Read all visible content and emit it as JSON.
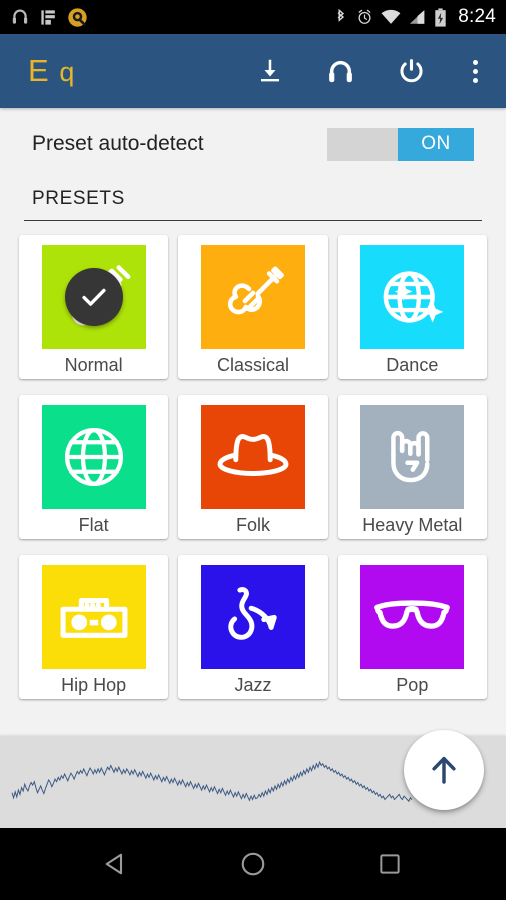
{
  "statusbar": {
    "time": "8:24",
    "left_icons": [
      "headphones-icon",
      "library-icon",
      "audio-app-icon"
    ],
    "right_icons": [
      "bluetooth-icon",
      "alarm-icon",
      "wifi-icon",
      "signal-icon",
      "battery-charging-icon"
    ]
  },
  "appbar": {
    "logo_e": "E",
    "logo_q": "q",
    "actions": [
      {
        "name": "download-icon",
        "label": "Download"
      },
      {
        "name": "headphones-icon",
        "label": "Headphones"
      },
      {
        "name": "power-icon",
        "label": "Power"
      },
      {
        "name": "overflow-menu-icon",
        "label": "More options"
      }
    ],
    "background_color": "#2B5580",
    "logo_color": "#E8B62A"
  },
  "auto_detect": {
    "label": "Preset auto-detect",
    "state": "ON",
    "on_color": "#35A8DC",
    "track_color": "#D4D4D4"
  },
  "presets_section": {
    "title": "PRESETS"
  },
  "presets": [
    {
      "label": "Normal",
      "icon": "guitar-icon",
      "color": "#AEE309",
      "selected": true
    },
    {
      "label": "Classical",
      "icon": "violin-icon",
      "color": "#FFAE10",
      "selected": false
    },
    {
      "label": "Dance",
      "icon": "discoball-icon",
      "color": "#17DCFB",
      "selected": false
    },
    {
      "label": "Flat",
      "icon": "globe-icon",
      "color": "#0AE08C",
      "selected": false
    },
    {
      "label": "Folk",
      "icon": "cowboyhat-icon",
      "color": "#E84607",
      "selected": false
    },
    {
      "label": "Heavy Metal",
      "icon": "rockhand-icon",
      "color": "#A3B0BD",
      "selected": false
    },
    {
      "label": "Hip Hop",
      "icon": "boombox-icon",
      "color": "#FBDD07",
      "selected": false
    },
    {
      "label": "Jazz",
      "icon": "saxophone-icon",
      "color": "#2B11EA",
      "selected": false
    },
    {
      "label": "Pop",
      "icon": "sunglasses-icon",
      "color": "#B10AF0",
      "selected": false
    }
  ],
  "waveform": {
    "name": "audio-spectrum-graph",
    "line_color": "#3C5A84",
    "background_color": "#DCDCDC",
    "points": [
      18,
      12,
      19,
      13,
      21,
      16,
      24,
      20,
      28,
      23,
      20,
      26,
      30,
      27,
      31,
      24,
      18,
      22,
      26,
      21,
      17,
      23,
      28,
      33,
      30,
      25,
      29,
      34,
      31,
      36,
      33,
      38,
      35,
      40,
      36,
      32,
      37,
      41,
      38,
      34,
      39,
      43,
      40,
      44,
      41,
      46,
      42,
      38,
      43,
      47,
      44,
      40,
      45,
      41,
      46,
      42,
      47,
      43,
      39,
      44,
      48,
      45,
      50,
      46,
      42,
      47,
      43,
      48,
      44,
      40,
      45,
      41,
      46,
      43,
      39,
      44,
      40,
      45,
      41,
      37,
      42,
      38,
      43,
      39,
      35,
      40,
      36,
      41,
      37,
      33,
      38,
      34,
      39,
      35,
      31,
      36,
      32,
      37,
      33,
      29,
      34,
      30,
      35,
      31,
      27,
      32,
      28,
      33,
      29,
      25,
      30,
      26,
      31,
      27,
      23,
      28,
      24,
      29,
      25,
      21,
      26,
      22,
      27,
      23,
      19,
      24,
      20,
      25,
      21,
      17,
      22,
      18,
      23,
      19,
      15,
      20,
      16,
      21,
      17,
      13,
      18,
      14,
      19,
      15,
      11,
      16,
      12,
      17,
      13,
      9,
      14,
      10,
      15,
      11,
      12,
      16,
      13,
      18,
      14,
      20,
      16,
      22,
      18,
      24,
      20,
      26,
      22,
      28,
      24,
      30,
      26,
      32,
      28,
      34,
      30,
      36,
      32,
      38,
      34,
      40,
      36,
      42,
      38,
      44,
      40,
      46,
      42,
      48,
      44,
      50,
      46,
      52,
      48,
      54,
      50,
      52,
      48,
      50,
      46,
      48,
      44,
      46,
      42,
      44,
      40,
      42,
      38,
      40,
      36,
      38,
      34,
      36,
      32,
      34,
      30,
      32,
      28,
      30,
      26,
      28,
      24,
      26,
      22,
      24,
      20,
      22,
      18,
      20,
      16,
      18,
      14,
      16,
      12,
      14,
      10,
      12,
      14,
      16,
      12,
      14,
      10,
      12,
      14,
      16,
      12,
      10,
      14,
      12,
      10,
      8,
      12,
      10
    ]
  },
  "fab": {
    "name": "scroll-up-fab",
    "icon": "arrow-up-icon",
    "arrow_color": "#2B4770"
  },
  "navbar": {
    "buttons": [
      {
        "name": "nav-back-button",
        "icon": "triangle-left-icon"
      },
      {
        "name": "nav-home-button",
        "icon": "circle-icon"
      },
      {
        "name": "nav-recents-button",
        "icon": "square-icon"
      }
    ]
  }
}
